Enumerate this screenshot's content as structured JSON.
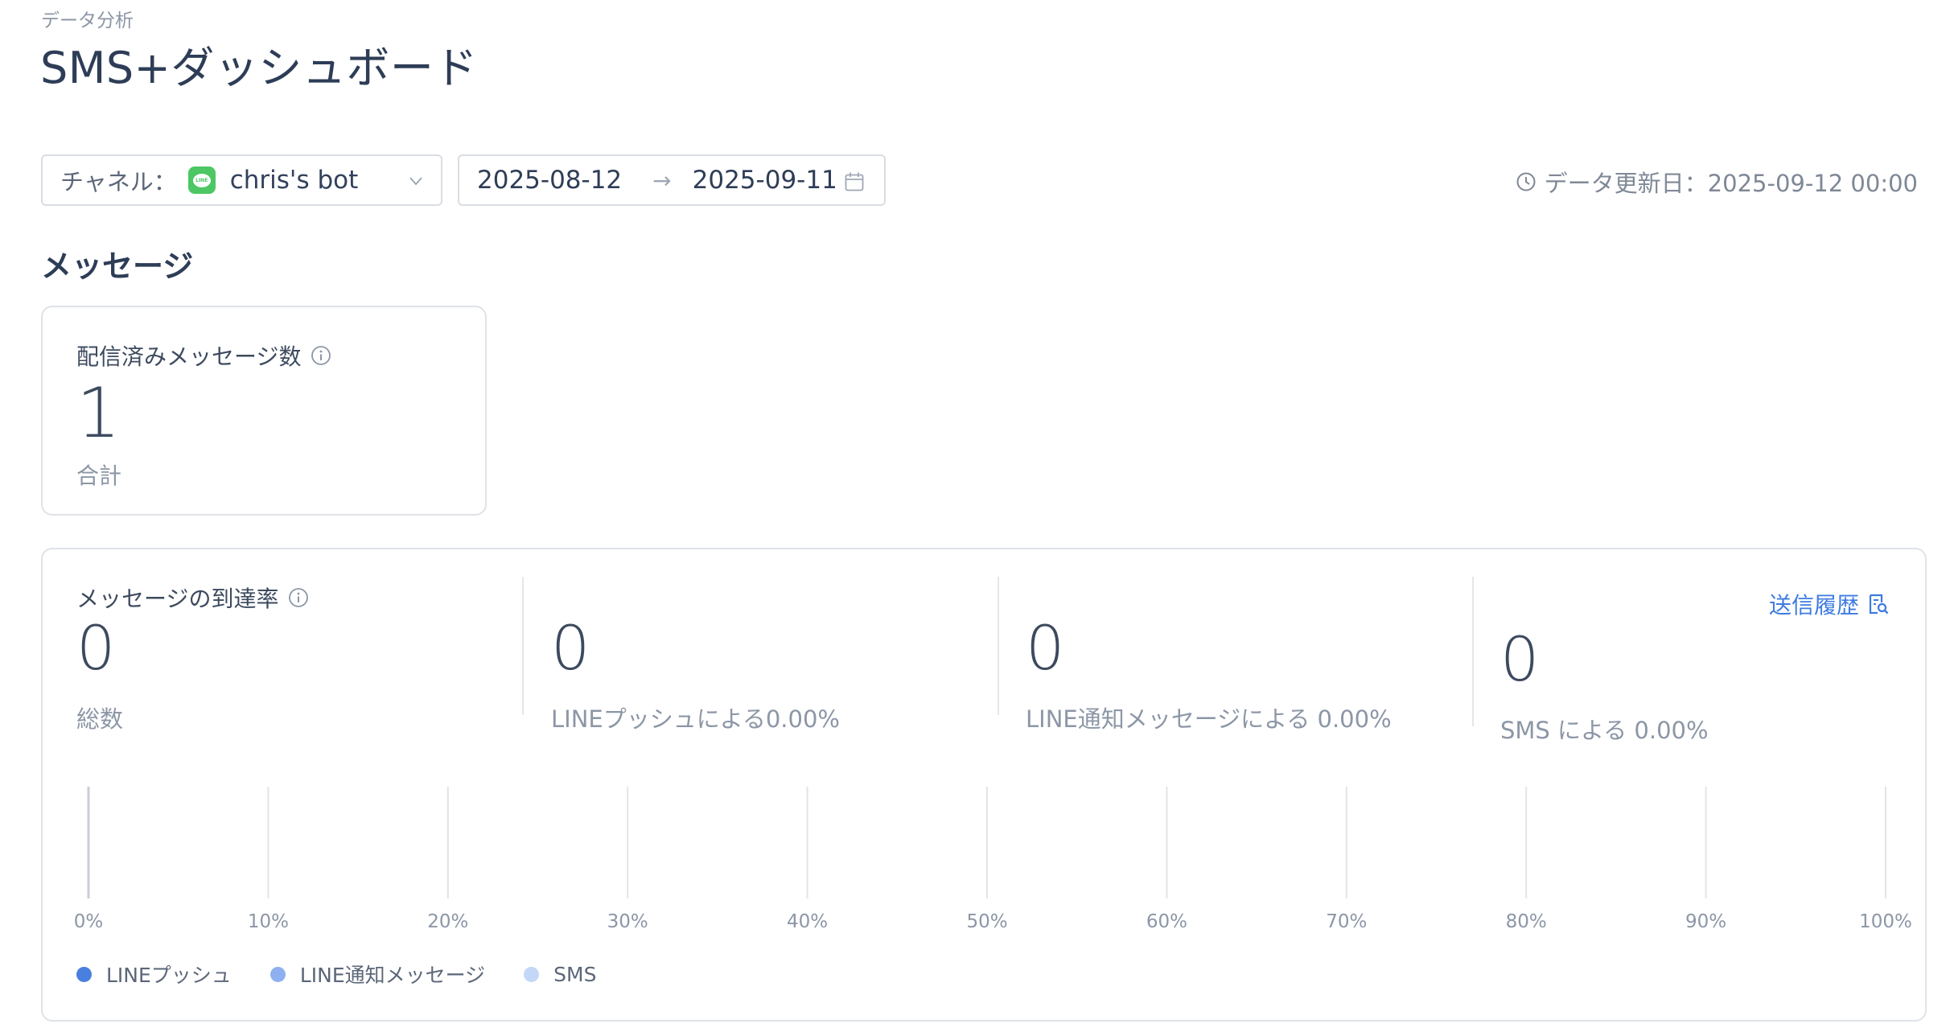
{
  "header": {
    "breadcrumb": "データ分析",
    "title": "SMS+ダッシュボード"
  },
  "filters": {
    "channel_label": "チャネル：",
    "channel_value": "chris's bot",
    "channel_icon": "line-logo-icon",
    "date_start": "2025-08-12",
    "date_separator": "→",
    "date_end": "2025-09-11",
    "updated_text": "データ更新日：2025-09-12 00:00"
  },
  "messages_section": {
    "title": "メッセージ",
    "delivered_card": {
      "label": "配信済みメッセージ数",
      "value": "1",
      "sub": "合計"
    },
    "reach_card": {
      "label": "メッセージの到達率",
      "history_link": "送信履歴",
      "stats": [
        {
          "value": "0",
          "sub": "総数"
        },
        {
          "value": "0",
          "sub": "LINEプッシュによる0.00%"
        },
        {
          "value": "0",
          "sub": "LINE通知メッセージによる 0.00%"
        },
        {
          "value": "0",
          "sub": "SMS による 0.00%"
        }
      ]
    }
  },
  "chart_data": {
    "type": "bar",
    "orientation": "horizontal-stacked",
    "x_ticks": [
      "0%",
      "10%",
      "20%",
      "30%",
      "40%",
      "50%",
      "60%",
      "70%",
      "80%",
      "90%",
      "100%"
    ],
    "xlim": [
      0,
      100
    ],
    "series": [
      {
        "name": "LINEプッシュ",
        "value": 0,
        "color": "#4a7fe0"
      },
      {
        "name": "LINE通知メッセージ",
        "value": 0,
        "color": "#8fb0f0"
      },
      {
        "name": "SMS",
        "value": 0,
        "color": "#c5d7f7"
      }
    ],
    "grid": true,
    "legend": "bottom-left"
  }
}
